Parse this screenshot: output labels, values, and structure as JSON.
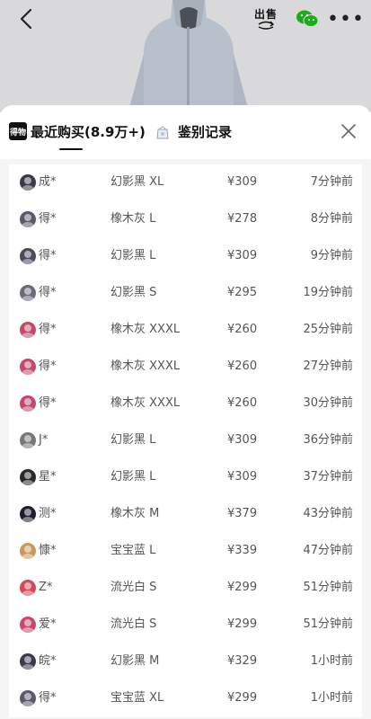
{
  "header": {
    "sell_label": "出售"
  },
  "tabs": [
    {
      "label": "最近购买(8.9万+)",
      "logo": "得物"
    },
    {
      "label": "鉴别记录"
    }
  ],
  "purchases": [
    {
      "user": "成*",
      "item": "幻影黑 XL",
      "price": "¥309",
      "time": "7分钟前",
      "avatar_color": "#3a3a4a"
    },
    {
      "user": "得*",
      "item": "橡木灰 L",
      "price": "¥278",
      "time": "8分钟前",
      "avatar_color": "#5a5a6a"
    },
    {
      "user": "得*",
      "item": "幻影黑 L",
      "price": "¥309",
      "time": "9分钟前",
      "avatar_color": "#4a4a5a"
    },
    {
      "user": "得*",
      "item": "幻影黑 S",
      "price": "¥295",
      "time": "19分钟前",
      "avatar_color": "#6a6a7a"
    },
    {
      "user": "得*",
      "item": "橡木灰 XXXL",
      "price": "¥260",
      "time": "25分钟前",
      "avatar_color": "#c04a6a"
    },
    {
      "user": "得*",
      "item": "橡木灰 XXXL",
      "price": "¥260",
      "time": "27分钟前",
      "avatar_color": "#c04a6a"
    },
    {
      "user": "得*",
      "item": "橡木灰 XXXL",
      "price": "¥260",
      "time": "30分钟前",
      "avatar_color": "#c04a6a"
    },
    {
      "user": "J*",
      "item": "幻影黑 L",
      "price": "¥309",
      "time": "36分钟前",
      "avatar_color": "#777777"
    },
    {
      "user": "星*",
      "item": "幻影黑 L",
      "price": "¥309",
      "time": "37分钟前",
      "avatar_color": "#2a2a2a"
    },
    {
      "user": "测*",
      "item": "橡木灰 M",
      "price": "¥379",
      "time": "43分钟前",
      "avatar_color": "#1e1e2e"
    },
    {
      "user": "慷*",
      "item": "宝宝蓝 L",
      "price": "¥339",
      "time": "47分钟前",
      "avatar_color": "#c89a5a"
    },
    {
      "user": "Z*",
      "item": "流光白 S",
      "price": "¥299",
      "time": "51分钟前",
      "avatar_color": "#d04a5a"
    },
    {
      "user": "爱*",
      "item": "流光白 S",
      "price": "¥299",
      "time": "51分钟前",
      "avatar_color": "#c84a6a"
    },
    {
      "user": "皖*",
      "item": "幻影黑 M",
      "price": "¥329",
      "time": "1小时前",
      "avatar_color": "#3a3a4a"
    },
    {
      "user": "得*",
      "item": "宝宝蓝 XL",
      "price": "¥299",
      "time": "1小时前",
      "avatar_color": "#5a5a6a"
    }
  ]
}
